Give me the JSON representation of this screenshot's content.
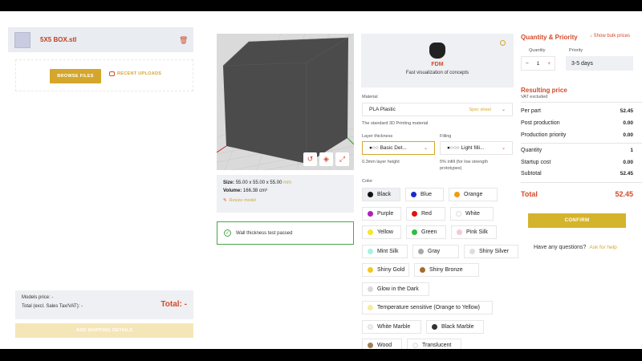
{
  "file": {
    "name": "5X5 BOX.stl"
  },
  "upload": {
    "browse_label": "BROWSE FILES",
    "recent_label": "RECENT UPLOADS"
  },
  "summary": {
    "models_price": "Models price: -",
    "total_excl": "Total (excl. Sales Tax/VAT): -",
    "total_label": "Total: -",
    "shipping_button": "ADD SHIPPING DETAILS"
  },
  "viewer": {
    "size_label": "Size:",
    "size_value": "55.00 x 55.00 x 55.00",
    "size_unit": "mm",
    "volume_label": "Volume:",
    "volume_value": "166.38 cm³",
    "resize_label": "Resize model"
  },
  "wall_check": "Wall thickness test passed",
  "technology": {
    "name": "FDM",
    "description": "Fast visualization of concepts"
  },
  "material": {
    "label": "Material",
    "value": "PLA Plastic",
    "spec_link": "Spec sheet",
    "description": "The standard 3D Printing material"
  },
  "layer": {
    "label": "Layer thickness",
    "value": "●○○ Basic Det...",
    "note": "0.3mm layer height"
  },
  "filling": {
    "label": "Filling",
    "value": "●○○○ Light filli...",
    "note1": "5% infill (for low strength",
    "note2": "prototypes)"
  },
  "color": {
    "label": "Color",
    "options": [
      {
        "name": "Black",
        "hex": "#111111"
      },
      {
        "name": "Blue",
        "hex": "#1a2ad0"
      },
      {
        "name": "Orange",
        "hex": "#f29a12"
      },
      {
        "name": "Purple",
        "hex": "#b01fb5"
      },
      {
        "name": "Red",
        "hex": "#e0120e"
      },
      {
        "name": "White",
        "hex": "#ffffff"
      },
      {
        "name": "Yellow",
        "hex": "#f6e62a"
      },
      {
        "name": "Green",
        "hex": "#2cbf3e"
      },
      {
        "name": "Pink Silk",
        "hex": "#f5c8d8"
      },
      {
        "name": "Mint Silk",
        "hex": "#a6f0e8"
      },
      {
        "name": "Gray",
        "hex": "#a8a8a8"
      },
      {
        "name": "Shiny Silver",
        "hex": "#dddddd"
      },
      {
        "name": "Shiny Gold",
        "hex": "#f2c821"
      },
      {
        "name": "Shiny Bronze",
        "hex": "#a86a28"
      },
      {
        "name": "Glow in the Dark",
        "hex": "#d8d8d8"
      },
      {
        "name": "Temperature sensitive (Orange to Yellow)",
        "hex": "#f7ec9a"
      },
      {
        "name": "White Marble",
        "hex": "#eeeeee"
      },
      {
        "name": "Black Marble",
        "hex": "#333333"
      },
      {
        "name": "Wood",
        "hex": "#a08058"
      },
      {
        "name": "Translucent",
        "hex": "#f7f7f7"
      }
    ]
  },
  "order": {
    "title": "Quantity & Priority",
    "bulk_link": "Show bulk prices",
    "quantity_label": "Quantity",
    "quantity_value": "1",
    "priority_label": "Priority",
    "priority_value": "3-5 days"
  },
  "price": {
    "title": "Resulting price",
    "vat_note": "VAT excluded",
    "per_part_label": "Per part",
    "per_part_value": "52.45",
    "post_label": "Post production",
    "post_value": "0.00",
    "prio_label": "Production priority",
    "prio_value": "0.00",
    "qty_label": "Quantity",
    "qty_value": "1",
    "startup_label": "Startup cost",
    "startup_value": "0.00",
    "subtotal_label": "Subtotal",
    "subtotal_value": "52.45",
    "total_label": "Total",
    "total_value": "52.45",
    "confirm_label": "CONFIRM",
    "questions": "Have any questions?",
    "help_link": "Ask for help"
  }
}
